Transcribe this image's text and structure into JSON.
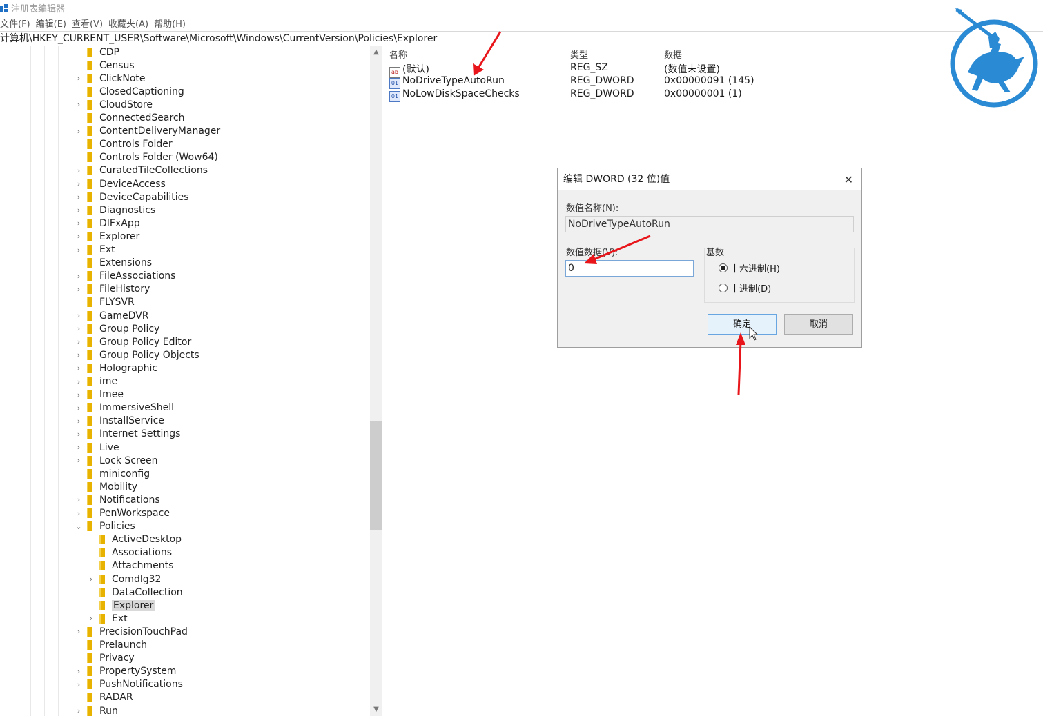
{
  "window": {
    "title": "注册表编辑器"
  },
  "menu": [
    "文件(F)",
    "编辑(E)",
    "查看(V)",
    "收藏夹(A)",
    "帮助(H)"
  ],
  "address": "计算机\\HKEY_CURRENT_USER\\Software\\Microsoft\\Windows\\CurrentVersion\\Policies\\Explorer",
  "tree": [
    {
      "label": "CDP",
      "exp": "",
      "lvl": 0
    },
    {
      "label": "Census",
      "exp": "",
      "lvl": 0
    },
    {
      "label": "ClickNote",
      "exp": ">",
      "lvl": 0
    },
    {
      "label": "ClosedCaptioning",
      "exp": "",
      "lvl": 0
    },
    {
      "label": "CloudStore",
      "exp": ">",
      "lvl": 0
    },
    {
      "label": "ConnectedSearch",
      "exp": "",
      "lvl": 0
    },
    {
      "label": "ContentDeliveryManager",
      "exp": ">",
      "lvl": 0
    },
    {
      "label": "Controls Folder",
      "exp": "",
      "lvl": 0
    },
    {
      "label": "Controls Folder (Wow64)",
      "exp": "",
      "lvl": 0
    },
    {
      "label": "CuratedTileCollections",
      "exp": ">",
      "lvl": 0
    },
    {
      "label": "DeviceAccess",
      "exp": ">",
      "lvl": 0
    },
    {
      "label": "DeviceCapabilities",
      "exp": ">",
      "lvl": 0
    },
    {
      "label": "Diagnostics",
      "exp": ">",
      "lvl": 0
    },
    {
      "label": "DIFxApp",
      "exp": ">",
      "lvl": 0
    },
    {
      "label": "Explorer",
      "exp": ">",
      "lvl": 0
    },
    {
      "label": "Ext",
      "exp": ">",
      "lvl": 0
    },
    {
      "label": "Extensions",
      "exp": "",
      "lvl": 0
    },
    {
      "label": "FileAssociations",
      "exp": ">",
      "lvl": 0
    },
    {
      "label": "FileHistory",
      "exp": ">",
      "lvl": 0
    },
    {
      "label": "FLYSVR",
      "exp": "",
      "lvl": 0
    },
    {
      "label": "GameDVR",
      "exp": ">",
      "lvl": 0
    },
    {
      "label": "Group Policy",
      "exp": ">",
      "lvl": 0
    },
    {
      "label": "Group Policy Editor",
      "exp": ">",
      "lvl": 0
    },
    {
      "label": "Group Policy Objects",
      "exp": ">",
      "lvl": 0
    },
    {
      "label": "Holographic",
      "exp": ">",
      "lvl": 0
    },
    {
      "label": "ime",
      "exp": ">",
      "lvl": 0
    },
    {
      "label": "Imee",
      "exp": ">",
      "lvl": 0
    },
    {
      "label": "ImmersiveShell",
      "exp": ">",
      "lvl": 0
    },
    {
      "label": "InstallService",
      "exp": ">",
      "lvl": 0
    },
    {
      "label": "Internet Settings",
      "exp": ">",
      "lvl": 0
    },
    {
      "label": "Live",
      "exp": ">",
      "lvl": 0
    },
    {
      "label": "Lock Screen",
      "exp": ">",
      "lvl": 0
    },
    {
      "label": "miniconfig",
      "exp": "",
      "lvl": 0
    },
    {
      "label": "Mobility",
      "exp": "",
      "lvl": 0
    },
    {
      "label": "Notifications",
      "exp": ">",
      "lvl": 0
    },
    {
      "label": "PenWorkspace",
      "exp": ">",
      "lvl": 0
    },
    {
      "label": "Policies",
      "exp": "v",
      "lvl": 0
    },
    {
      "label": "ActiveDesktop",
      "exp": "",
      "lvl": 1
    },
    {
      "label": "Associations",
      "exp": "",
      "lvl": 1
    },
    {
      "label": "Attachments",
      "exp": "",
      "lvl": 1
    },
    {
      "label": "Comdlg32",
      "exp": ">",
      "lvl": 1
    },
    {
      "label": "DataCollection",
      "exp": "",
      "lvl": 1
    },
    {
      "label": "Explorer",
      "exp": "",
      "lvl": 1,
      "selected": true
    },
    {
      "label": "Ext",
      "exp": ">",
      "lvl": 1
    },
    {
      "label": "PrecisionTouchPad",
      "exp": ">",
      "lvl": 0
    },
    {
      "label": "Prelaunch",
      "exp": "",
      "lvl": 0
    },
    {
      "label": "Privacy",
      "exp": "",
      "lvl": 0
    },
    {
      "label": "PropertySystem",
      "exp": ">",
      "lvl": 0
    },
    {
      "label": "PushNotifications",
      "exp": ">",
      "lvl": 0
    },
    {
      "label": "RADAR",
      "exp": "",
      "lvl": 0
    },
    {
      "label": "Run",
      "exp": ">",
      "lvl": 0
    }
  ],
  "values_pane": {
    "headers": {
      "name": "名称",
      "type": "类型",
      "data": "数据"
    },
    "rows": [
      {
        "icon": "ab",
        "name": "(默认)",
        "type": "REG_SZ",
        "data": "(数值未设置)"
      },
      {
        "icon": "bin",
        "name": "NoDriveTypeAutoRun",
        "type": "REG_DWORD",
        "data": "0x00000091 (145)"
      },
      {
        "icon": "bin",
        "name": "NoLowDiskSpaceChecks",
        "type": "REG_DWORD",
        "data": "0x00000001 (1)"
      }
    ]
  },
  "dialog": {
    "title": "编辑 DWORD (32 位)值",
    "name_label": "数值名称(N):",
    "name_value": "NoDriveTypeAutoRun",
    "data_label": "数值数据(V):",
    "data_value": "0",
    "base_label": "基数",
    "hex_label": "十六进制(H)",
    "dec_label": "十进制(D)",
    "hex_selected": true,
    "ok_label": "确定",
    "cancel_label": "取消"
  },
  "colors": {
    "folder": "#e7b300",
    "arrow": "#e8161a",
    "logo": "#2a8ad4",
    "ok_border": "#67a6e0",
    "ok_fill": "#e5f1fb"
  }
}
